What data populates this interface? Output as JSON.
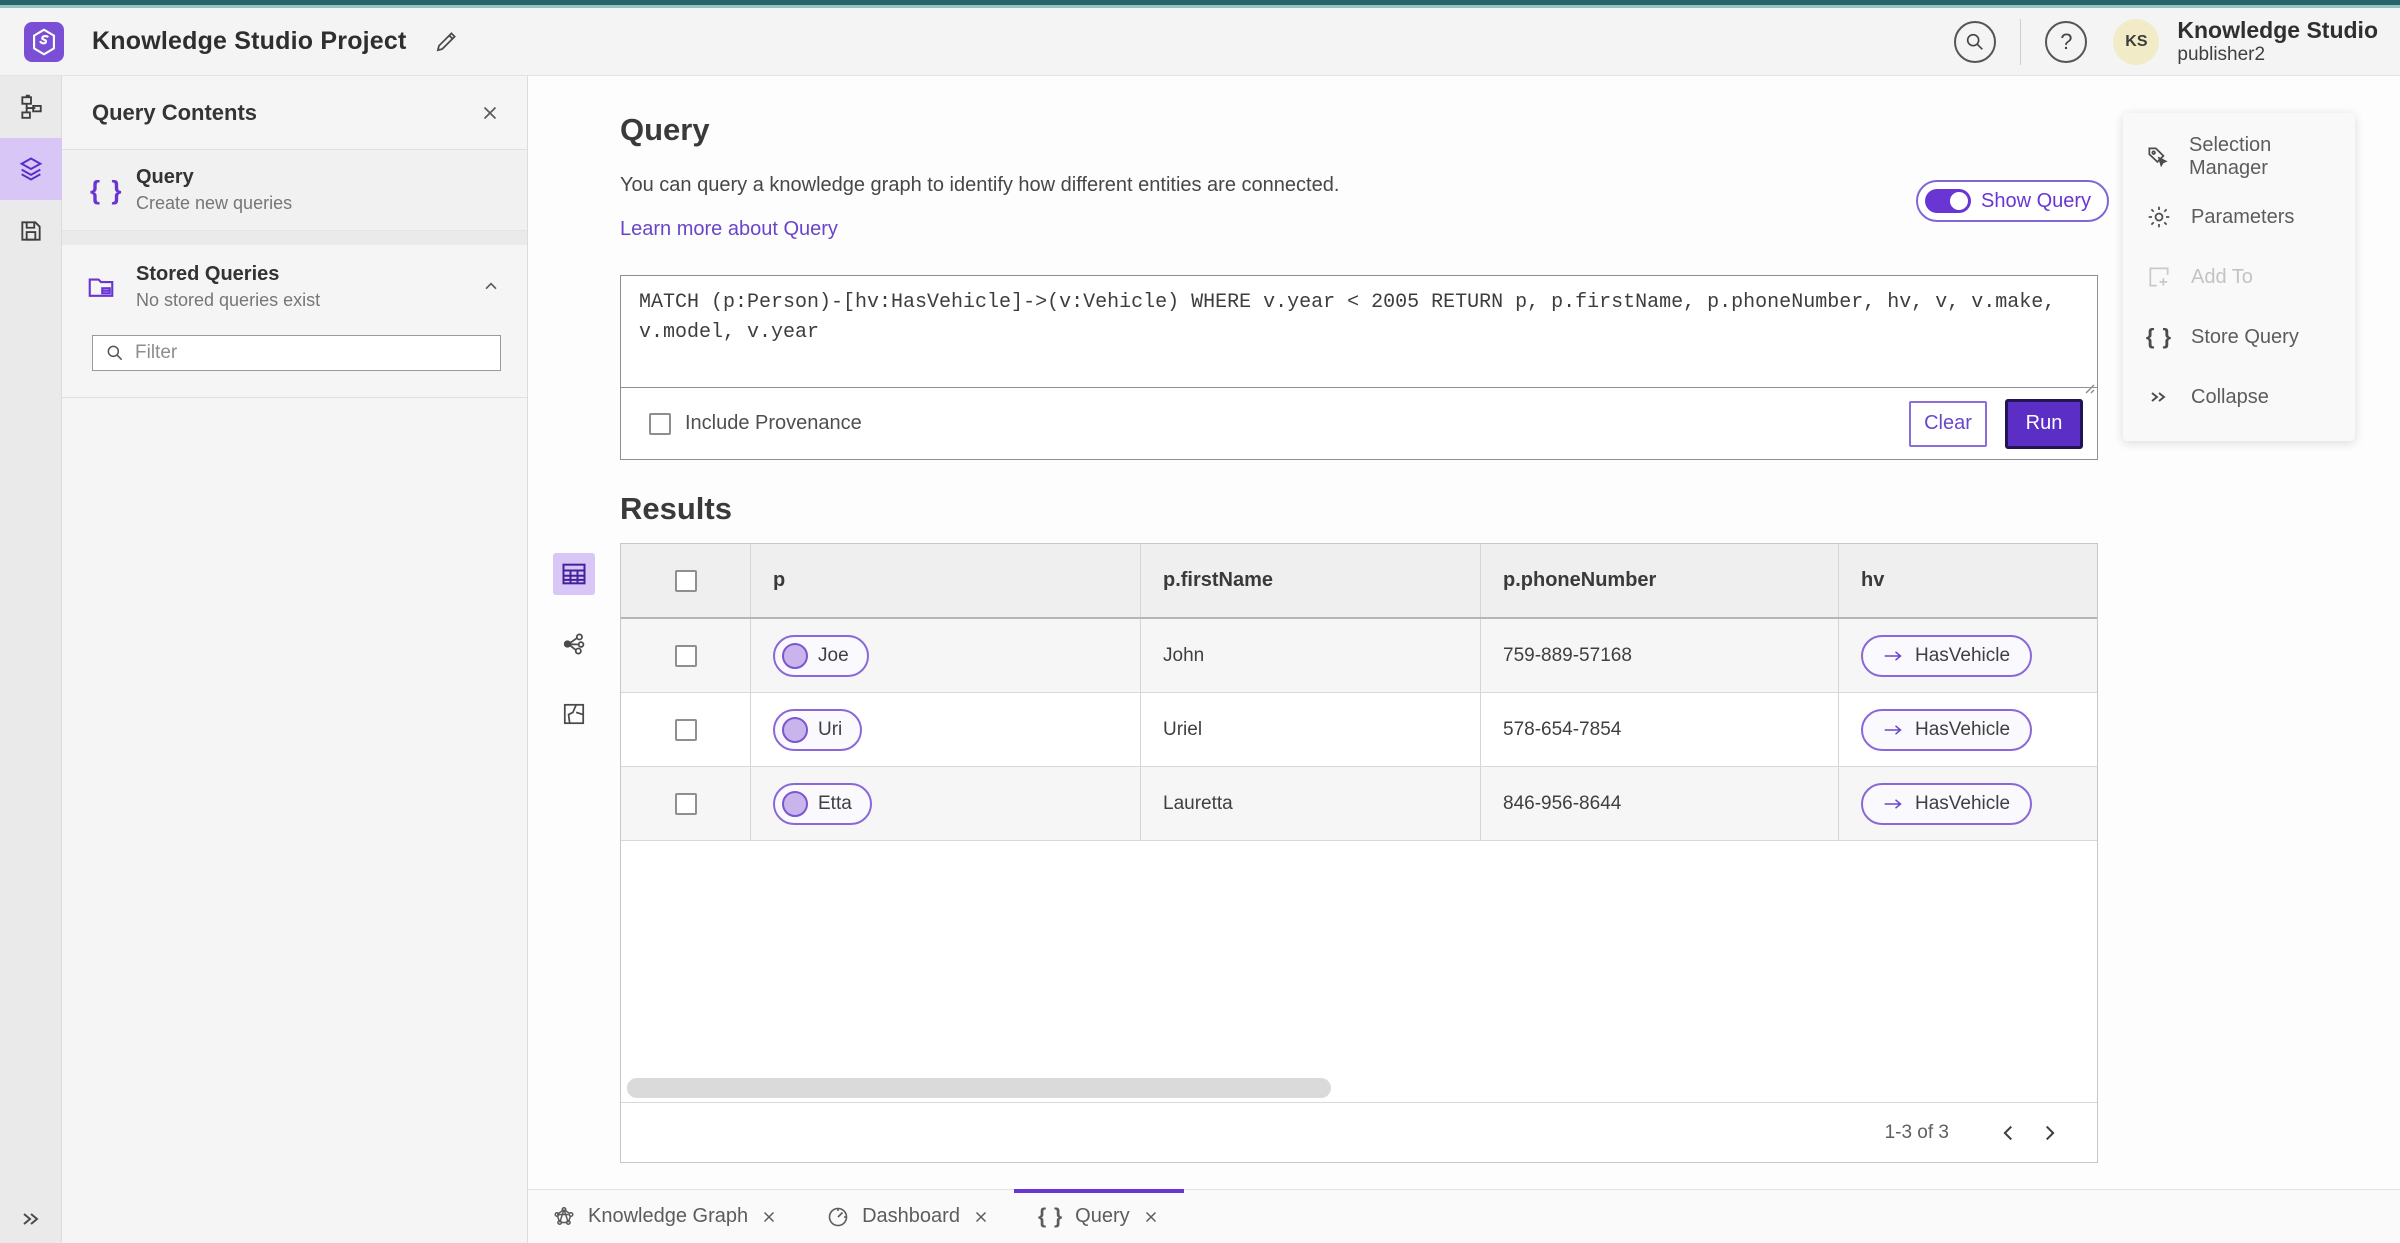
{
  "header": {
    "title": "Knowledge Studio Project",
    "product_name": "Knowledge Studio",
    "user_name": "publisher2",
    "avatar_initials": "KS",
    "help_glyph": "?"
  },
  "sidebar": {
    "panel_title": "Query Contents",
    "query_item": {
      "label": "Query",
      "description": "Create new queries"
    },
    "stored_queries": {
      "label": "Stored Queries",
      "description": "No stored queries exist"
    },
    "filter_placeholder": "Filter"
  },
  "query_section": {
    "title": "Query",
    "description": "You can query a knowledge graph to identify how different entities are connected.",
    "learn_more": "Learn more about Query",
    "show_query_label": "Show Query",
    "query_text": "MATCH (p:Person)-[hv:HasVehicle]->(v:Vehicle) WHERE v.year < 2005 RETURN p, p.firstName, p.phoneNumber, hv, v, v.make, v.model, v.year",
    "include_provenance_label": "Include Provenance",
    "clear_label": "Clear",
    "run_label": "Run"
  },
  "results": {
    "title": "Results",
    "columns": [
      "p",
      "p.firstName",
      "p.phoneNumber",
      "hv"
    ],
    "rows": [
      {
        "p": "Joe",
        "firstName": "John",
        "phoneNumber": "759-889-57168",
        "hv": "HasVehicle"
      },
      {
        "p": "Uri",
        "firstName": "Uriel",
        "phoneNumber": "578-654-7854",
        "hv": "HasVehicle"
      },
      {
        "p": "Etta",
        "firstName": "Lauretta",
        "phoneNumber": "846-956-8644",
        "hv": "HasVehicle"
      }
    ],
    "pagination": "1-3 of 3"
  },
  "right_panel": {
    "items": [
      {
        "label": "Selection Manager"
      },
      {
        "label": "Parameters"
      },
      {
        "label": "Add To"
      },
      {
        "label": "Store Query"
      },
      {
        "label": "Collapse"
      }
    ]
  },
  "bottom_tabs": [
    {
      "label": "Knowledge Graph"
    },
    {
      "label": "Dashboard"
    },
    {
      "label": "Query"
    }
  ],
  "icons": {
    "braces": "{ }"
  },
  "colors": {
    "accent_purple": "#6935d3",
    "run_button": "#5b2ec5",
    "rail_selected_bg": "#d8c6f7",
    "teal_strip": "#26646a",
    "link": "#6946c8",
    "avatar_bg": "#f1ecc7",
    "pill_border": "#8a68d9",
    "pill_dot": "#c9b5ec"
  }
}
